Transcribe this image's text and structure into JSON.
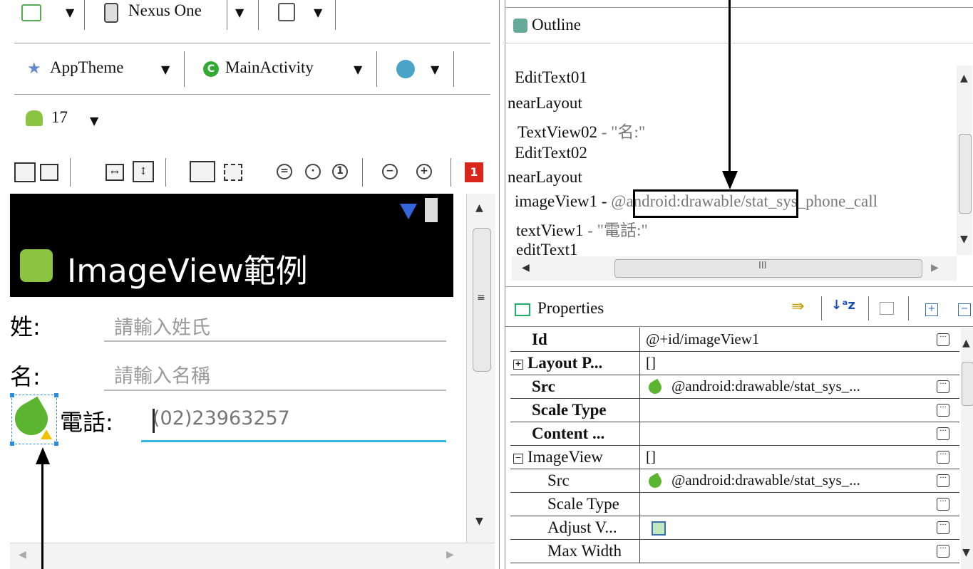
{
  "toolbar": {
    "device": "Nexus One",
    "theme": "AppTheme",
    "activity": "MainActivity",
    "api_level": "17",
    "error_count": "1"
  },
  "device": {
    "app_title": "ImageView範例",
    "fields": [
      {
        "label": "姓:",
        "hint": "請輸入姓氏"
      },
      {
        "label": "名:",
        "hint": "請輸入名稱"
      }
    ],
    "phone_label": "電話:",
    "phone_value": "(02)23963257"
  },
  "outline": {
    "title": "Outline",
    "items": [
      {
        "text": "EditText01",
        "extra": "",
        "indent": 1
      },
      {
        "text": "nearLayout",
        "extra": "",
        "indent": 0
      },
      {
        "text": "TextView02",
        "extra": " - \"名:\"",
        "indent": 1
      },
      {
        "text": "EditText02",
        "extra": "",
        "indent": 1
      },
      {
        "text": "nearLayout",
        "extra": "",
        "indent": 0
      },
      {
        "text": "imageView1 - ",
        "extra": "@android:drawable/stat_sys_phone_call",
        "indent": 1
      },
      {
        "text": "textView1",
        "extra": " - \"電話:\"",
        "indent": 1
      },
      {
        "text": "editText1",
        "extra": "",
        "indent": 1
      }
    ],
    "scroll_mid": "III"
  },
  "properties": {
    "title": "Properties",
    "rows": [
      {
        "name": "Id",
        "value": "@+id/imageView1",
        "bold": true,
        "expander": "",
        "icon": false,
        "indent": false
      },
      {
        "name": "Layout P...",
        "value": "[]",
        "bold": true,
        "expander": "+",
        "icon": false,
        "indent": false
      },
      {
        "name": "Src",
        "value": "@android:drawable/stat_sys_...",
        "bold": true,
        "expander": "",
        "icon": true,
        "indent": false
      },
      {
        "name": "Scale Type",
        "value": "",
        "bold": true,
        "expander": "",
        "icon": false,
        "indent": false
      },
      {
        "name": "Content ...",
        "value": "",
        "bold": true,
        "expander": "",
        "icon": false,
        "indent": false
      },
      {
        "name": "ImageView",
        "value": "[]",
        "bold": false,
        "expander": "−",
        "icon": false,
        "indent": false
      },
      {
        "name": "Src",
        "value": "@android:drawable/stat_sys_...",
        "bold": false,
        "expander": "",
        "icon": true,
        "indent": true
      },
      {
        "name": "Scale Type",
        "value": "",
        "bold": false,
        "expander": "",
        "icon": false,
        "indent": true
      },
      {
        "name": "Adjust V...",
        "value": "",
        "bold": false,
        "expander": "",
        "icon": false,
        "indent": true,
        "checkbox": true
      },
      {
        "name": "Max Width",
        "value": "",
        "bold": false,
        "expander": "",
        "icon": false,
        "indent": true
      }
    ]
  },
  "colors": {
    "accent": "#33b5e5",
    "phone_green": "#5cb531",
    "error_red": "#d9261c"
  }
}
